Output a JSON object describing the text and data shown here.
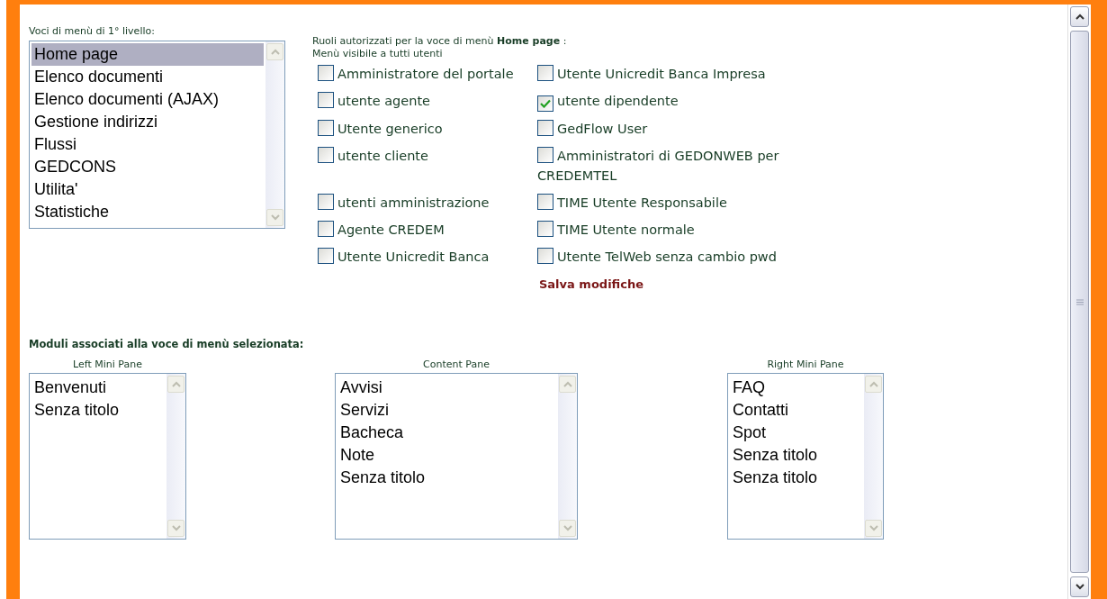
{
  "top_menu": {
    "label": "Voci di menù di 1° livello:",
    "items": [
      {
        "label": "Home page",
        "selected": true
      },
      {
        "label": "Elenco documenti",
        "selected": false
      },
      {
        "label": "Elenco documenti (AJAX)",
        "selected": false
      },
      {
        "label": "Gestione indirizzi",
        "selected": false
      },
      {
        "label": "Flussi",
        "selected": false
      },
      {
        "label": "GEDCONS",
        "selected": false
      },
      {
        "label": "Utilita'",
        "selected": false
      },
      {
        "label": "Statistiche",
        "selected": false
      }
    ]
  },
  "roles": {
    "title": "Ruoli autorizzati per la voce di menù **Home page** :",
    "subtitle": "Menù visibile a tutti utenti",
    "items": [
      {
        "label": "Amministratore del portale",
        "checked": false
      },
      {
        "label": "Utente Unicredit Banca Impresa",
        "checked": false
      },
      {
        "label": "utente agente",
        "checked": false
      },
      {
        "label": "utente dipendente",
        "checked": true
      },
      {
        "label": "Utente generico",
        "checked": false
      },
      {
        "label": "GedFlow User",
        "checked": false
      },
      {
        "label": "utente cliente",
        "checked": false
      },
      {
        "label": "Amministratori di GEDONWEB per CREDEMTEL",
        "checked": false
      },
      {
        "label": "utenti amministrazione",
        "checked": false
      },
      {
        "label": "TIME Utente Responsabile",
        "checked": false
      },
      {
        "label": "Agente CREDEM",
        "checked": false
      },
      {
        "label": "TIME Utente normale",
        "checked": false
      },
      {
        "label": "Utente Unicredit Banca",
        "checked": false
      },
      {
        "label": "Utente TelWeb senza cambio pwd",
        "checked": false
      }
    ],
    "save_link": "Salva modifiche"
  },
  "modules": {
    "title": "Moduli associati alla voce di menù selezionata:",
    "panes": [
      {
        "label": "Left Mini Pane",
        "items": [
          "Benvenuti",
          "Senza titolo"
        ]
      },
      {
        "label": "Content Pane",
        "items": [
          "Avvisi",
          "Servizi",
          "Bacheca",
          "Note",
          "Senza titolo"
        ]
      },
      {
        "label": "Right Mini Pane",
        "items": [
          "FAQ",
          "Contatti",
          "Spot",
          "Senza titolo",
          "Senza titolo"
        ]
      }
    ]
  }
}
